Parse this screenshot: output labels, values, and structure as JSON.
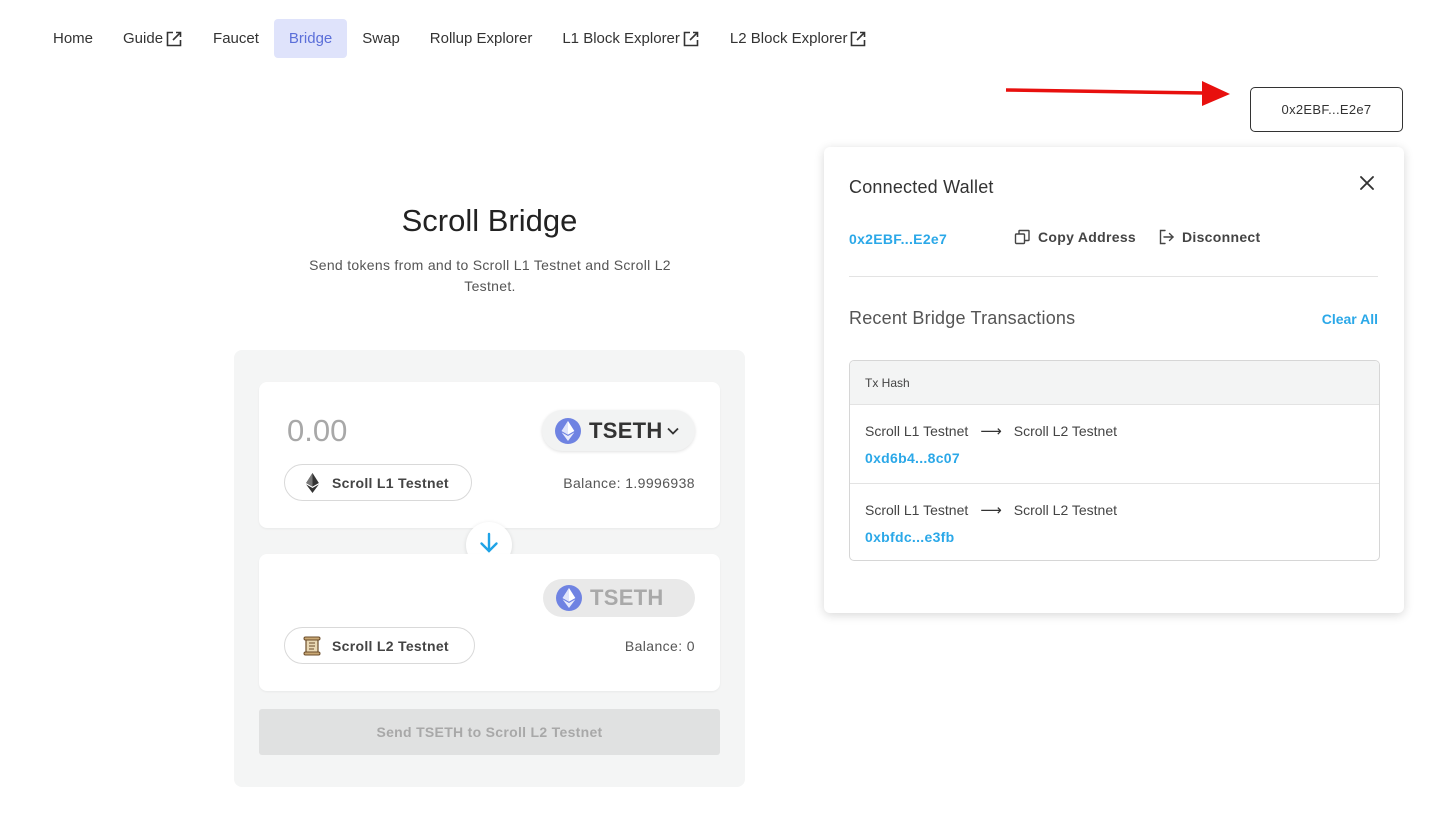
{
  "nav": {
    "items": [
      {
        "label": "Home",
        "external": false,
        "active": false
      },
      {
        "label": "Guide",
        "external": true,
        "active": false
      },
      {
        "label": "Faucet",
        "external": false,
        "active": false
      },
      {
        "label": "Bridge",
        "external": false,
        "active": true
      },
      {
        "label": "Swap",
        "external": false,
        "active": false
      },
      {
        "label": "Rollup Explorer",
        "external": false,
        "active": false
      },
      {
        "label": "L1 Block Explorer",
        "external": true,
        "active": false
      },
      {
        "label": "L2 Block Explorer",
        "external": true,
        "active": false
      }
    ]
  },
  "wallet_button": {
    "label": "0x2EBF...E2e7"
  },
  "bridge": {
    "title": "Scroll Bridge",
    "subtitle": "Send tokens from and to Scroll L1 Testnet and Scroll L2 Testnet.",
    "from": {
      "amount_placeholder": "0.00",
      "token": "TSETH",
      "network": "Scroll L1 Testnet",
      "balance": "Balance: 1.9996938"
    },
    "to": {
      "token": "TSETH",
      "network": "Scroll L2 Testnet",
      "balance": "Balance: 0"
    },
    "send_label": "Send TSETH to Scroll L2 Testnet"
  },
  "wallet_popover": {
    "title": "Connected Wallet",
    "address": "0x2EBF...E2e7",
    "copy_label": "Copy Address",
    "disconnect_label": "Disconnect",
    "recent_title": "Recent Bridge Transactions",
    "clear_label": "Clear All",
    "table_header": "Tx Hash",
    "transactions": [
      {
        "from": "Scroll L1 Testnet",
        "arrow": "⟶",
        "to": "Scroll L2 Testnet",
        "hash": "0xd6b4...8c07"
      },
      {
        "from": "Scroll L1 Testnet",
        "arrow": "⟶",
        "to": "Scroll L2 Testnet",
        "hash": "0xbfdc...e3fb"
      }
    ]
  },
  "colors": {
    "accent_blue": "#2ba8e8",
    "nav_active_bg": "#dfe3fb",
    "nav_active_text": "#5b6fd9",
    "eth_purple": "#6f83e2",
    "annotation_red": "#e8100e"
  },
  "icons": {
    "external_link": "external-link-icon",
    "eth": "ethereum-icon",
    "scroll": "scroll-icon",
    "swap_direction": "arrow-down-icon",
    "close": "close-icon",
    "copy": "copy-icon",
    "disconnect": "logout-icon"
  }
}
